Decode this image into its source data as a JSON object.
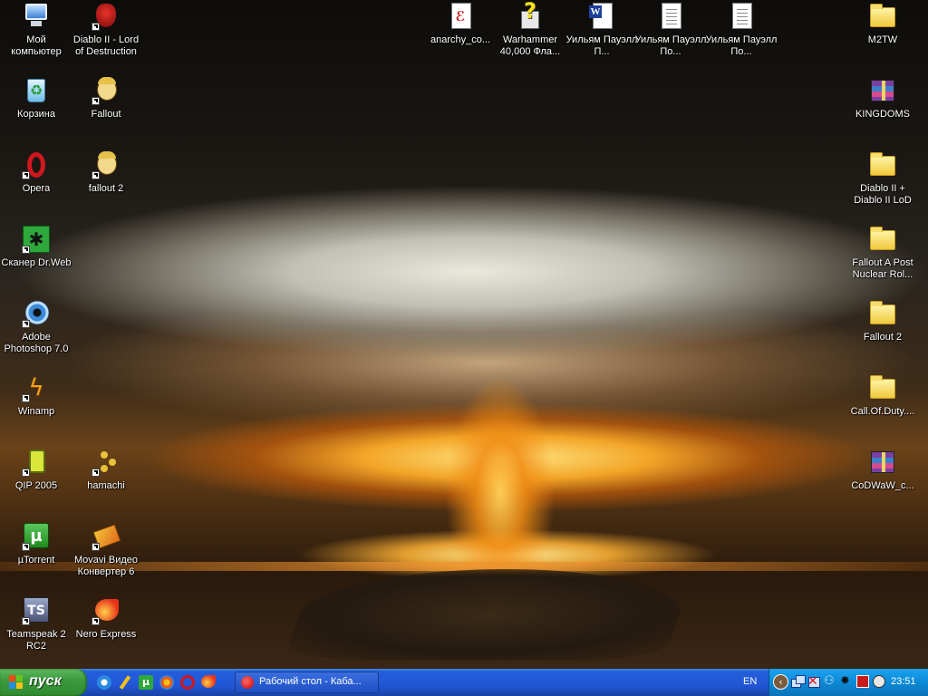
{
  "desktop": {
    "icons": [
      {
        "id": "my_computer",
        "label": "Мой компьютер",
        "icon": "computer-icon",
        "shortcut": false
      },
      {
        "id": "diablo",
        "label": "Diablo II - Lord of Destruction",
        "icon": "diablo-icon",
        "shortcut": true
      },
      {
        "id": "anarchy",
        "label": "anarchy_co...",
        "icon": "pdf-icon",
        "shortcut": false
      },
      {
        "id": "warhammer",
        "label": "Warhammer 40,000 Фла...",
        "icon": "help-file-icon",
        "shortcut": false
      },
      {
        "id": "powell1",
        "label": "Уильям Пауэлл П...",
        "icon": "word-document-icon",
        "shortcut": false
      },
      {
        "id": "powell2",
        "label": "Уильям Пауэлл По...",
        "icon": "text-document-icon",
        "shortcut": false
      },
      {
        "id": "powell3",
        "label": "Уильям Пауэлл По...",
        "icon": "text-document-icon",
        "shortcut": false
      },
      {
        "id": "m2tw",
        "label": "M2TW",
        "icon": "folder-icon",
        "shortcut": false
      },
      {
        "id": "recycle",
        "label": "Корзина",
        "icon": "recycle-bin-icon",
        "shortcut": false
      },
      {
        "id": "fallout",
        "label": "Fallout",
        "icon": "vault-boy-icon",
        "shortcut": true
      },
      {
        "id": "kingdoms",
        "label": "KINGDOMS",
        "icon": "winrar-archive-icon",
        "shortcut": false
      },
      {
        "id": "opera",
        "label": "Opera",
        "icon": "opera-icon",
        "shortcut": true
      },
      {
        "id": "fallout2",
        "label": "fallout 2",
        "icon": "vault-boy-icon",
        "shortcut": true
      },
      {
        "id": "diablo_folder",
        "label": "Diablo II + Diablo II LoD",
        "icon": "folder-icon",
        "shortcut": false
      },
      {
        "id": "drweb",
        "label": "Сканер Dr.Web",
        "icon": "drweb-spider-icon",
        "shortcut": true
      },
      {
        "id": "fallout_post",
        "label": "Fallout A Post Nuclear Rol...",
        "icon": "folder-icon",
        "shortcut": false
      },
      {
        "id": "photoshop",
        "label": "Adobe Photoshop 7.0",
        "icon": "photoshop-eye-icon",
        "shortcut": true
      },
      {
        "id": "fallout2_folder",
        "label": "Fallout 2",
        "icon": "folder-icon",
        "shortcut": false
      },
      {
        "id": "winamp",
        "label": "Winamp",
        "icon": "winamp-bolt-icon",
        "shortcut": true
      },
      {
        "id": "cod",
        "label": "Call.Of.Duty....",
        "icon": "folder-icon",
        "shortcut": false
      },
      {
        "id": "qip",
        "label": "QIP 2005",
        "icon": "qip-icon",
        "shortcut": true
      },
      {
        "id": "hamachi",
        "label": "hamachi",
        "icon": "hamachi-icon",
        "shortcut": true
      },
      {
        "id": "codwaw",
        "label": "CoDWaW_c...",
        "icon": "winrar-archive-icon",
        "shortcut": false
      },
      {
        "id": "utorrent",
        "label": "µTorrent",
        "icon": "utorrent-icon",
        "shortcut": true
      },
      {
        "id": "movavi",
        "label": "Movavi Видео Конвертер 6",
        "icon": "movavi-icon",
        "shortcut": true
      },
      {
        "id": "teamspeak",
        "label": "Teamspeak 2 RC2",
        "icon": "teamspeak-icon",
        "shortcut": true
      },
      {
        "id": "nero",
        "label": "Nero Express",
        "icon": "nero-flame-icon",
        "shortcut": true
      }
    ]
  },
  "taskbar": {
    "start_label": "пуск",
    "quick_launch": [
      "ie-icon",
      "pencil-app-icon",
      "utorrent-small-icon",
      "media-player-icon",
      "opera-small-icon",
      "nero-small-icon"
    ],
    "task_button_label": "Рабочий стол - Каба...",
    "language": "EN",
    "tray_icons": [
      "network-icon",
      "network-disconnected-icon",
      "connection-icon",
      "bat-icon",
      "antivirus-icon",
      "qip-tray-icon"
    ],
    "clock": "23:51"
  },
  "colors": {
    "taskbar_blue": "#245edb",
    "start_green": "#3c9a3c",
    "tray_blue": "#0c89d6"
  }
}
